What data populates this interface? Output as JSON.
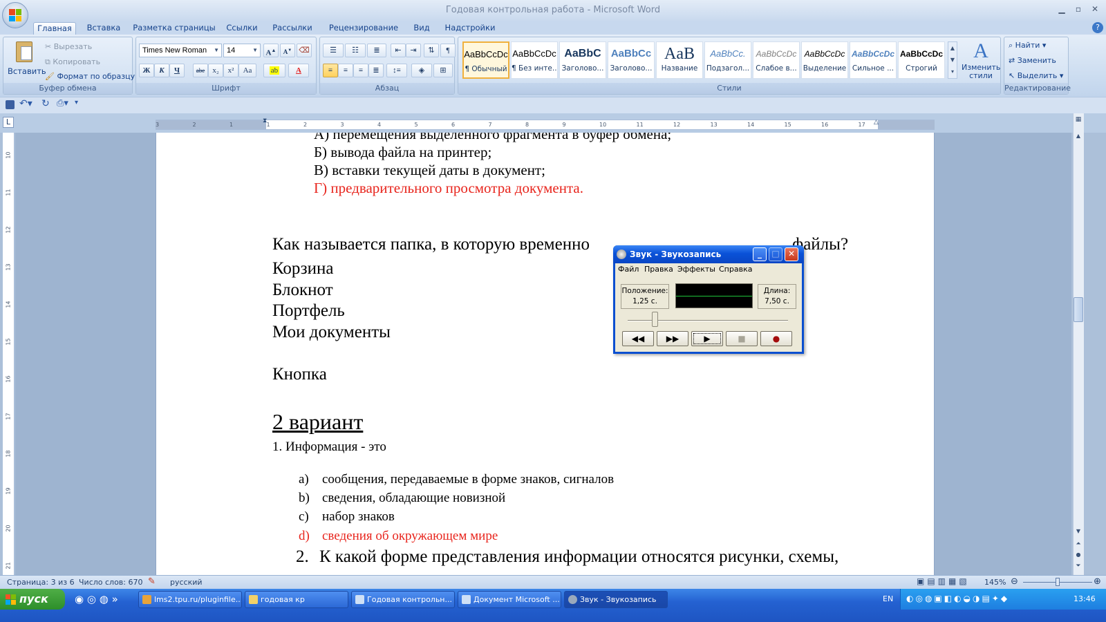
{
  "window": {
    "title": "Годовая контрольная работа - Microsoft Word"
  },
  "tabs": [
    "Главная",
    "Вставка",
    "Разметка страницы",
    "Ссылки",
    "Рассылки",
    "Рецензирование",
    "Вид",
    "Надстройки"
  ],
  "ribbon": {
    "clipboard": {
      "paste": "Вставить",
      "cut": "Вырезать",
      "copy": "Копировать",
      "format_painter": "Формат по образцу",
      "label": "Буфер обмена"
    },
    "font": {
      "name": "Times New Roman",
      "size": "14",
      "label": "Шрифт",
      "bold": "Ж",
      "italic": "К",
      "underline": "Ч",
      "strike": "abe",
      "sub": "x₂",
      "sup": "x²",
      "case": "Aa",
      "grow": "A",
      "shrink": "A",
      "color_letter": "A"
    },
    "paragraph": {
      "label": "Абзац"
    },
    "styles": {
      "label": "Стили",
      "items": [
        {
          "sample": "AaBbCcDc",
          "name": "¶ Обычный"
        },
        {
          "sample": "AaBbCcDc",
          "name": "¶ Без инте..."
        },
        {
          "sample": "AaBbC",
          "name": "Заголово..."
        },
        {
          "sample": "AaBbCc",
          "name": "Заголово..."
        },
        {
          "sample": "AaB",
          "name": "Название"
        },
        {
          "sample": "AaBbCc.",
          "name": "Подзагол..."
        },
        {
          "sample": "AaBbCcDc",
          "name": "Слабое в..."
        },
        {
          "sample": "AaBbCcDc",
          "name": "Выделение"
        },
        {
          "sample": "AaBbCcDc",
          "name": "Сильное ..."
        },
        {
          "sample": "AaBbCcDc",
          "name": "Строгий"
        }
      ],
      "change_styles": "Изменить стили"
    },
    "editing": {
      "find": "Найти",
      "replace": "Заменить",
      "select": "Выделить",
      "label": "Редактирование"
    }
  },
  "document": {
    "answers_top": [
      "А) перемещения выделенного фрагмента в буфер обмена;",
      "Б) вывода файла на принтер;",
      "В) вставки текущей даты в документ;",
      "Г) предварительного просмотра документа."
    ],
    "question_start": "Как называется папка, в которую временно",
    "question_end": "файлы?",
    "options": [
      "Корзина",
      "Блокнот",
      "Портфель",
      "Мои документы"
    ],
    "button_word": "Кнопка",
    "variant_heading": "2 вариант",
    "q1": "1. Информация  - это",
    "q1_options": [
      {
        "letter": "a)",
        "text": "сообщения, передаваемые  в форме знаков, сигналов"
      },
      {
        "letter": "b)",
        "text": "сведения, обладающие новизной"
      },
      {
        "letter": "c)",
        "text": "набор знаков"
      },
      {
        "letter": "d)",
        "text": "сведения об окружающем мире"
      }
    ],
    "q2_num": "2.",
    "q2": "К какой форме представления информации относятся рисунки, схемы,"
  },
  "ruler": {
    "h_ticks": [
      "3",
      "2",
      "1",
      "1",
      "2",
      "3",
      "4",
      "5",
      "6",
      "7",
      "8",
      "9",
      "10",
      "11",
      "12",
      "13",
      "14",
      "15",
      "16",
      "17"
    ],
    "v_ticks": [
      "10",
      "11",
      "12",
      "13",
      "14",
      "15",
      "16",
      "17",
      "18",
      "19",
      "20",
      "21"
    ]
  },
  "sound_recorder": {
    "title": "Звук - Звукозапись",
    "menu": [
      "Файл",
      "Правка",
      "Эффекты",
      "Справка"
    ],
    "position_label": "Положение:",
    "position_value": "1,25 с.",
    "length_label": "Длина:",
    "length_value": "7,50 с.",
    "position_fraction": 0.167
  },
  "statusbar": {
    "page": "Страница: 3 из 6",
    "words": "Число слов: 670",
    "language": "русский",
    "zoom": "145%"
  },
  "taskbar": {
    "start": "пуск",
    "tasks": [
      "lms2.tpu.ru/pluginfile....",
      "годовая кр",
      "Годовая контрольн...",
      "Документ Microsoft ...",
      "Звук - Звукозапись"
    ],
    "lang": "EN",
    "time": "13:46"
  }
}
